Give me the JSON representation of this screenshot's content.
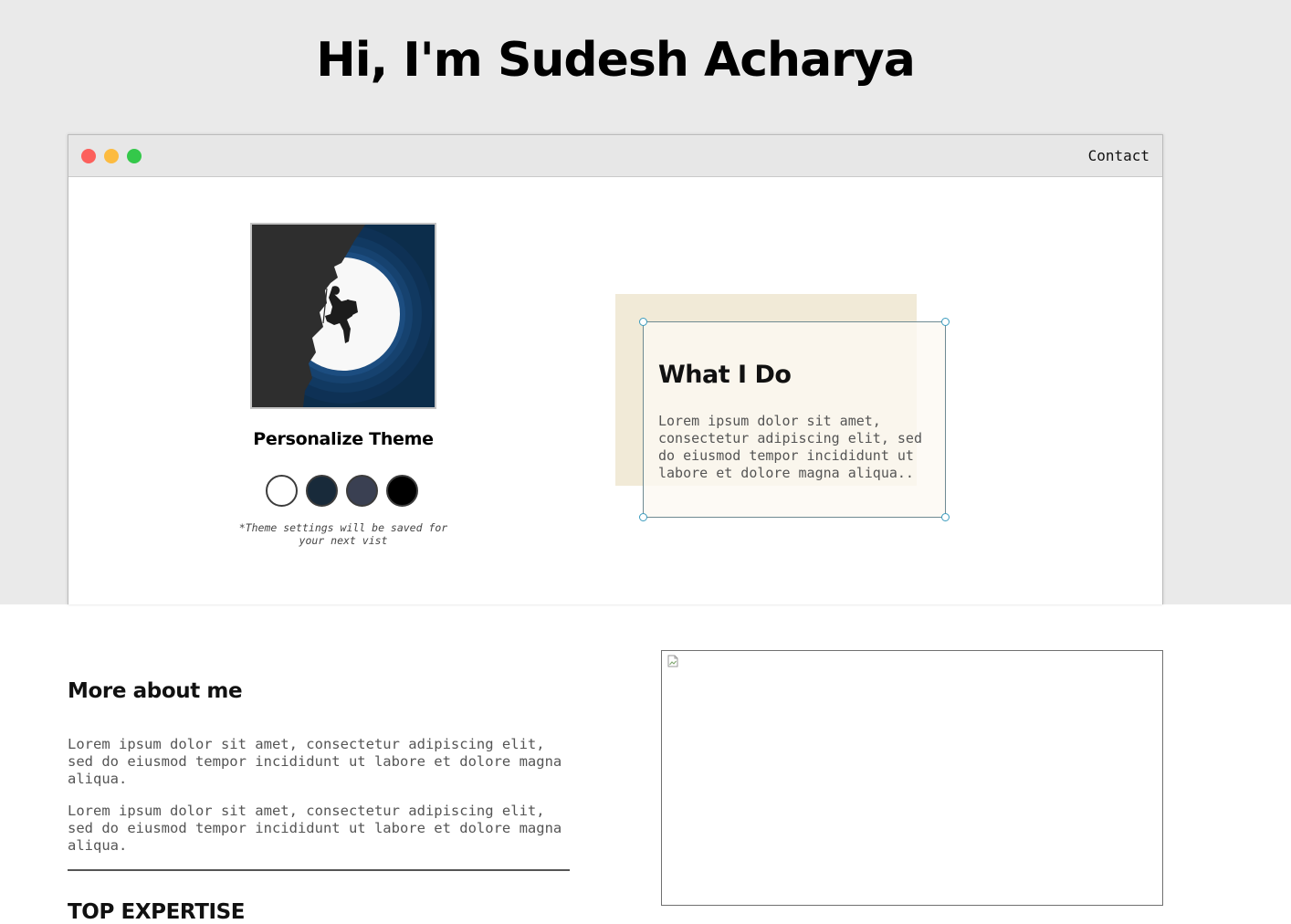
{
  "hero": {
    "title": "Hi, I'm Sudesh Acharya"
  },
  "window": {
    "traffic_lights": [
      "#fc605c",
      "#fcbb40",
      "#34c84a"
    ],
    "nav_link": "Contact"
  },
  "profile": {
    "avatar_icon": "climber-moon-illustration",
    "theme_title": "Personalize Theme",
    "theme_swatches": [
      {
        "name": "white",
        "color": "#ffffff"
      },
      {
        "name": "navy",
        "color": "#182a3a"
      },
      {
        "name": "slate",
        "color": "#3a4052"
      },
      {
        "name": "black",
        "color": "#000000"
      }
    ],
    "theme_note": "*Theme settings will be saved for your next vist"
  },
  "what_i_do": {
    "title": "What I Do",
    "text": "Lorem ipsum dolor sit amet, consectetur adipiscing elit, sed do eiusmod tempor incididunt ut labore et dolore magna aliqua.."
  },
  "about": {
    "title": "More about me",
    "paragraphs": [
      "Lorem ipsum dolor sit amet, consectetur adipiscing elit, sed do eiusmod tempor incididunt ut labore et dolore magna aliqua.",
      "Lorem ipsum dolor sit amet, consectetur adipiscing elit, sed do eiusmod tempor incididunt ut labore et dolore magna aliqua."
    ],
    "expertise_title": "TOP EXPERTISE"
  },
  "media": {
    "icon": "broken-image-icon"
  },
  "colors": {
    "hero_bg": "#eaeaea",
    "card_bg": "#f1ead7",
    "handle_accent": "#3a9bbd"
  }
}
